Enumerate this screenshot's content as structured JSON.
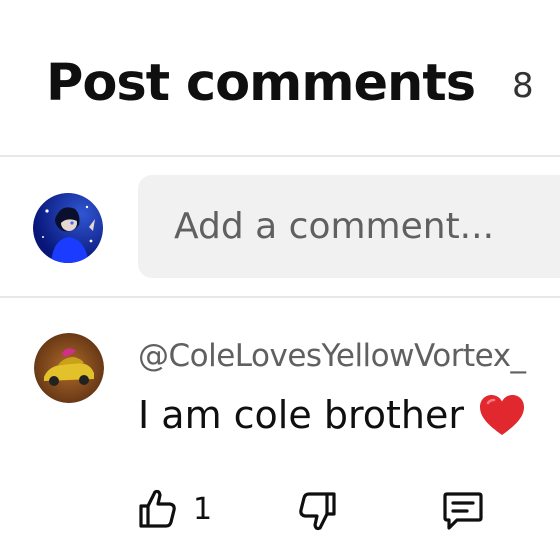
{
  "header": {
    "title": "Post comments",
    "count": "8"
  },
  "composer": {
    "placeholder": "Add a comment...",
    "avatar_icon": "user-avatar-icon"
  },
  "comments": [
    {
      "author": "@ColeLovesYellowVortex_",
      "text": "I am cole brother",
      "emoji_icon": "red-heart-icon",
      "like_count": "1",
      "avatar_icon": "car-avatar-icon"
    }
  ],
  "actions": {
    "like_icon": "thumbs-up-icon",
    "dislike_icon": "thumbs-down-icon",
    "reply_icon": "reply-comment-icon"
  },
  "colors": {
    "text_primary": "#0f0f0f",
    "text_secondary": "#606060",
    "input_background": "#f1f1f1",
    "divider": "#e8e8e8",
    "heart": "#e0282e"
  }
}
